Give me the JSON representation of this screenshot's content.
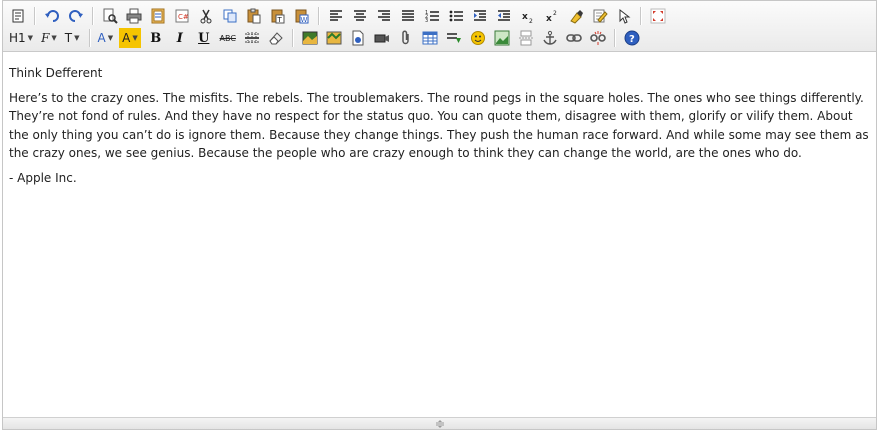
{
  "toolbar": {
    "row1": [
      {
        "name": "source-icon"
      },
      {
        "sep": true
      },
      {
        "name": "undo-icon"
      },
      {
        "name": "redo-icon"
      },
      {
        "sep": true
      },
      {
        "name": "preview-icon"
      },
      {
        "name": "print-icon"
      },
      {
        "name": "template-icon"
      },
      {
        "name": "code-snippet-icon"
      },
      {
        "name": "cut-icon"
      },
      {
        "name": "copy-icon"
      },
      {
        "name": "paste-icon"
      },
      {
        "name": "paste-text-icon"
      },
      {
        "name": "paste-word-icon"
      },
      {
        "sep": true
      },
      {
        "name": "align-left-icon"
      },
      {
        "name": "align-center-icon"
      },
      {
        "name": "align-right-icon"
      },
      {
        "name": "justify-icon"
      },
      {
        "name": "ordered-list-icon"
      },
      {
        "name": "unordered-list-icon"
      },
      {
        "name": "indent-icon"
      },
      {
        "name": "outdent-icon"
      },
      {
        "name": "subscript-icon"
      },
      {
        "name": "superscript-icon"
      },
      {
        "name": "clear-format-icon"
      },
      {
        "name": "quick-format-icon"
      },
      {
        "name": "select-all-icon"
      },
      {
        "sep": true
      },
      {
        "name": "fullscreen-icon"
      }
    ],
    "row2": {
      "heading_label": "H1",
      "font_family_label": "F",
      "font_size_label": "T",
      "text_color_label": "A",
      "highlight_label": "A",
      "bold_label": "B",
      "italic_label": "I",
      "underline_label": "U",
      "strike_label": "ABC"
    }
  },
  "colors": {
    "accent_red": "#d33a2a",
    "accent_blue": "#2f5fbf",
    "highlight_yellow": "#f5c400",
    "text": "#222222"
  },
  "content": {
    "title": "Think Defferent",
    "paragraph": "Here’s to the crazy ones. The misfits. The rebels. The troublemakers. The round pegs in the square holes. The ones who see things differently. They’re not fond of rules. And they have no respect for the status quo. You can quote them, disagree with them, glorify or vilify them. About the only thing you can’t do is ignore them. Because they change things. They push the human race forward. And while some may see them as the crazy ones, we see genius. Because the people who are crazy enough to think they can change the world, are the ones who do.",
    "signature": "- Apple Inc."
  }
}
